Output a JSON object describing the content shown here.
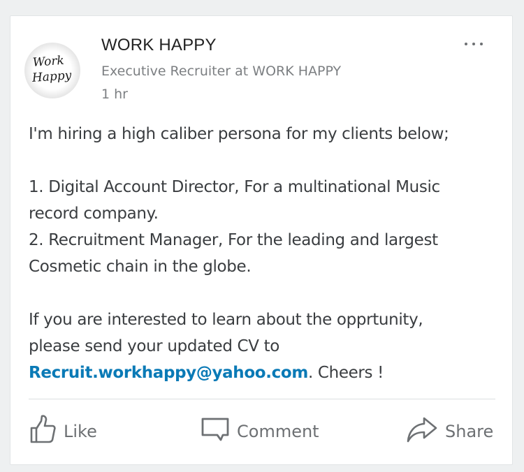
{
  "post": {
    "author": {
      "name": "WORK HAPPY",
      "headline": "Executive Recruiter at WORK HAPPY",
      "timestamp": "1 hr",
      "avatar_text_line1": "Work",
      "avatar_text_line2": "Happy",
      "avatar_icon": "work-happy-logo"
    },
    "more_icon": "ellipsis-icon",
    "body": {
      "line1": "I'm hiring a high caliber persona for my clients below;",
      "line2": "1. Digital Account Director, For a multinational Music",
      "line3": "record company.",
      "line4": "2. Recruitment Manager, For the leading and largest",
      "line5": "Cosmetic chain in the globe.",
      "line6": "If you are interested to learn about the opprtunity,",
      "line7": "please send your updated CV to",
      "email": "Recruit.workhappy@yahoo.com",
      "closing": ". Cheers !"
    },
    "actions": {
      "like_label": "Like",
      "like_icon": "thumbs-up-icon",
      "comment_label": "Comment",
      "comment_icon": "comment-bubble-icon",
      "share_label": "Share",
      "share_icon": "share-arrow-icon"
    }
  },
  "colors": {
    "background": "#eef0f1",
    "card": "#ffffff",
    "text_primary": "#222222",
    "text_body": "#3a3d40",
    "text_muted": "#7c7f82",
    "link": "#0a7ab6",
    "divider": "#dcdfe1"
  }
}
